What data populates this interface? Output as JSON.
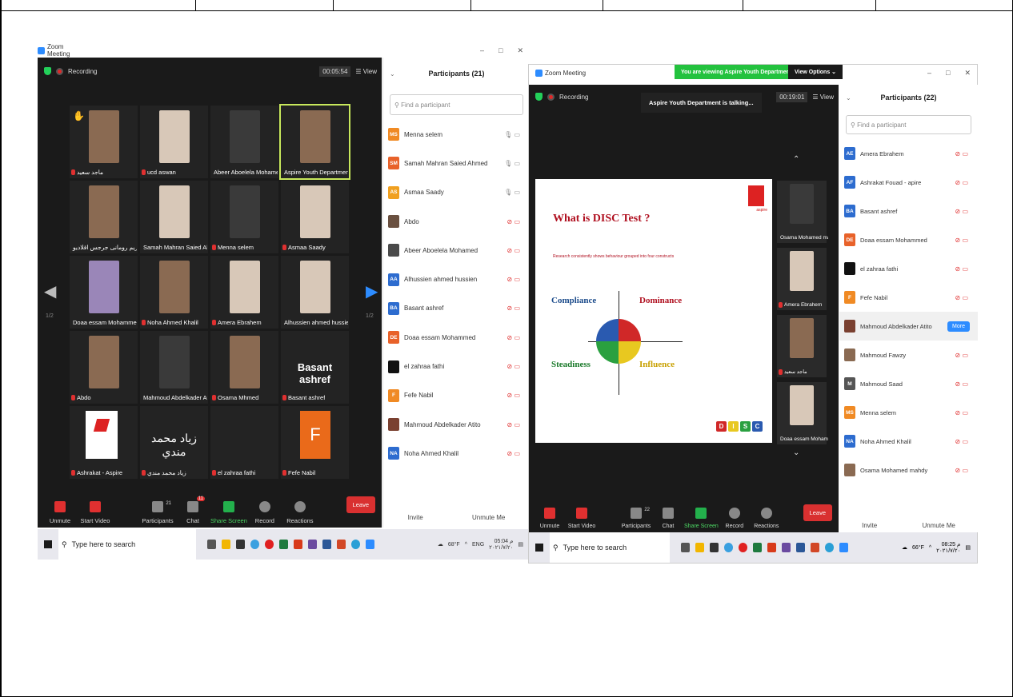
{
  "left": {
    "window_title": "Zoom Meeting",
    "recording": "Recording",
    "timer": "00:05:54",
    "view": "View",
    "page_left": "1/2",
    "page_right": "1/2",
    "tiles": [
      {
        "name": "ماجد سعيد",
        "photo": "brown",
        "hand": true
      },
      {
        "name": "ucd aswan",
        "photo": "light"
      },
      {
        "name": "Abeer Aboelela Mohamed",
        "photo": "dark"
      },
      {
        "name": "Aspire Youth Department",
        "photo": "brown",
        "active": true
      },
      {
        "name": "مريم رومانى جرجس اقلاديو",
        "photo": "brown"
      },
      {
        "name": "Samah Mahran Saied Ahmed",
        "photo": "light"
      },
      {
        "name": "Menna selem",
        "photo": "dark"
      },
      {
        "name": "Asmaa Saady",
        "photo": "light"
      },
      {
        "name": "Doaa essam Mohammed",
        "photo": "purple"
      },
      {
        "name": "Noha Ahmed Khalil",
        "photo": "brown"
      },
      {
        "name": "Amera Ebrahem",
        "photo": "light"
      },
      {
        "name": "Alhussien ahmed hussien",
        "photo": "light"
      },
      {
        "name": "Abdo",
        "photo": "brown"
      },
      {
        "name": "Mahmoud Abdelkader At...",
        "photo": "dark"
      },
      {
        "name": "Osama Mhmed",
        "photo": "brown"
      },
      {
        "name": "Basant ashref",
        "big": "Basant ashref"
      },
      {
        "name": "Ashrakat - Aspire",
        "logo": "aspire"
      },
      {
        "name": "زياد محمد مندي",
        "arabic": "زياد محمد مندي"
      },
      {
        "name": "el zahraa fathi",
        "photo": "none"
      },
      {
        "name": "Fefe Nabil",
        "letter": "F"
      }
    ],
    "controls": {
      "unmute": "Unmute",
      "start_video": "Start Video",
      "participants": "Participants",
      "participants_count": "21",
      "chat": "Chat",
      "chat_badge": "11",
      "share": "Share Screen",
      "record": "Record",
      "reactions": "Reactions",
      "leave": "Leave"
    },
    "panel": {
      "title": "Participants (21)",
      "search_placeholder": "Find a participant",
      "rows": [
        {
          "initials": "MS",
          "color": "#f08a24",
          "name": "Menna selem",
          "muted": false
        },
        {
          "initials": "SM",
          "color": "#e8622a",
          "name": "Samah Mahran Saied Ahmed",
          "muted": false
        },
        {
          "initials": "AS",
          "color": "#f0a020",
          "name": "Asmaa Saady",
          "muted": false
        },
        {
          "initials": "",
          "color": "#6a5040",
          "name": "Abdo",
          "muted": true
        },
        {
          "initials": "",
          "color": "#4a4a4a",
          "name": "Abeer Aboelela Mohamed",
          "muted": true
        },
        {
          "initials": "AA",
          "color": "#2d6ccf",
          "name": "Alhussien ahmed hussien",
          "muted": true
        },
        {
          "initials": "BA",
          "color": "#2d6ccf",
          "name": "Basant ashref",
          "muted": true
        },
        {
          "initials": "DE",
          "color": "#e8622a",
          "name": "Doaa essam Mohammed",
          "muted": true
        },
        {
          "initials": "",
          "color": "#111111",
          "name": "el zahraa fathi",
          "muted": true
        },
        {
          "initials": "F",
          "color": "#f08a24",
          "name": "Fefe Nabil",
          "muted": true
        },
        {
          "initials": "",
          "color": "#7a4030",
          "name": "Mahmoud Abdelkader Atito",
          "muted": true
        },
        {
          "initials": "NA",
          "color": "#2d6ccf",
          "name": "Noha Ahmed Khalil",
          "muted": true
        }
      ],
      "invite": "Invite",
      "unmute_me": "Unmute Me"
    },
    "taskbar": {
      "search": "Type here to search",
      "weather": "68°F",
      "lang": "ENG",
      "time": "05:04 م",
      "date": "٢٠٢١/٧/٢٠"
    }
  },
  "right": {
    "window_title": "Zoom Meeting",
    "banner": "You are viewing Aspire Youth Department's screen",
    "view_options": "View Options",
    "recording": "Recording",
    "talking": "Aspire Youth Department is talking...",
    "timer": "00:19:01",
    "view": "View",
    "slide": {
      "title": "What is DISC Test ?",
      "subtitle": "Research consistently shows behaviour grouped into four constructs",
      "compliance": "Compliance",
      "dominance": "Dominance",
      "steadiness": "Steadiness",
      "influence": "Influence",
      "brand": "aspire",
      "blocks": [
        "D",
        "I",
        "S",
        "C"
      ]
    },
    "side_tiles": [
      {
        "name": "Osama Mohamed mah...",
        "photo": "dark"
      },
      {
        "name": "Amera Ebrahem",
        "photo": "light"
      },
      {
        "name": "ماجد سعيد",
        "photo": "brown"
      },
      {
        "name": "Doaa essam Mohamm...",
        "photo": "light"
      }
    ],
    "controls": {
      "unmute": "Unmute",
      "start_video": "Start Video",
      "participants": "Participants",
      "participants_count": "22",
      "chat": "Chat",
      "share": "Share Screen",
      "record": "Record",
      "reactions": "Reactions",
      "leave": "Leave"
    },
    "panel": {
      "title": "Participants (22)",
      "search_placeholder": "Find a participant",
      "more": "More",
      "rows": [
        {
          "initials": "AE",
          "color": "#2d6ccf",
          "name": "Amera Ebrahem"
        },
        {
          "initials": "AF",
          "color": "#2d6ccf",
          "name": "Ashrakat Fouad - apire"
        },
        {
          "initials": "BA",
          "color": "#2d6ccf",
          "name": "Basant ashref"
        },
        {
          "initials": "DE",
          "color": "#e8622a",
          "name": "Doaa essam Mohammed"
        },
        {
          "initials": "",
          "color": "#111111",
          "name": "el zahraa fathi"
        },
        {
          "initials": "F",
          "color": "#f08a24",
          "name": "Fefe Nabil"
        },
        {
          "initials": "",
          "color": "#7a4030",
          "name": "Mahmoud Abdelkader Atito",
          "more": true
        },
        {
          "initials": "",
          "color": "#8a6a52",
          "name": "Mahmoud Fawzy"
        },
        {
          "initials": "M",
          "color": "#555555",
          "name": "Mahmoud Saad"
        },
        {
          "initials": "MS",
          "color": "#f08a24",
          "name": "Menna selem"
        },
        {
          "initials": "NA",
          "color": "#2d6ccf",
          "name": "Noha Ahmed Khalil"
        },
        {
          "initials": "",
          "color": "#8a6a52",
          "name": "Osama Mohamed mahdy"
        }
      ],
      "invite": "Invite",
      "unmute_me": "Unmute Me"
    },
    "taskbar": {
      "search": "Type here to search",
      "weather": "66°F",
      "time": "08:25 م",
      "date": "٢٠٢١/٧/٢٠"
    }
  }
}
